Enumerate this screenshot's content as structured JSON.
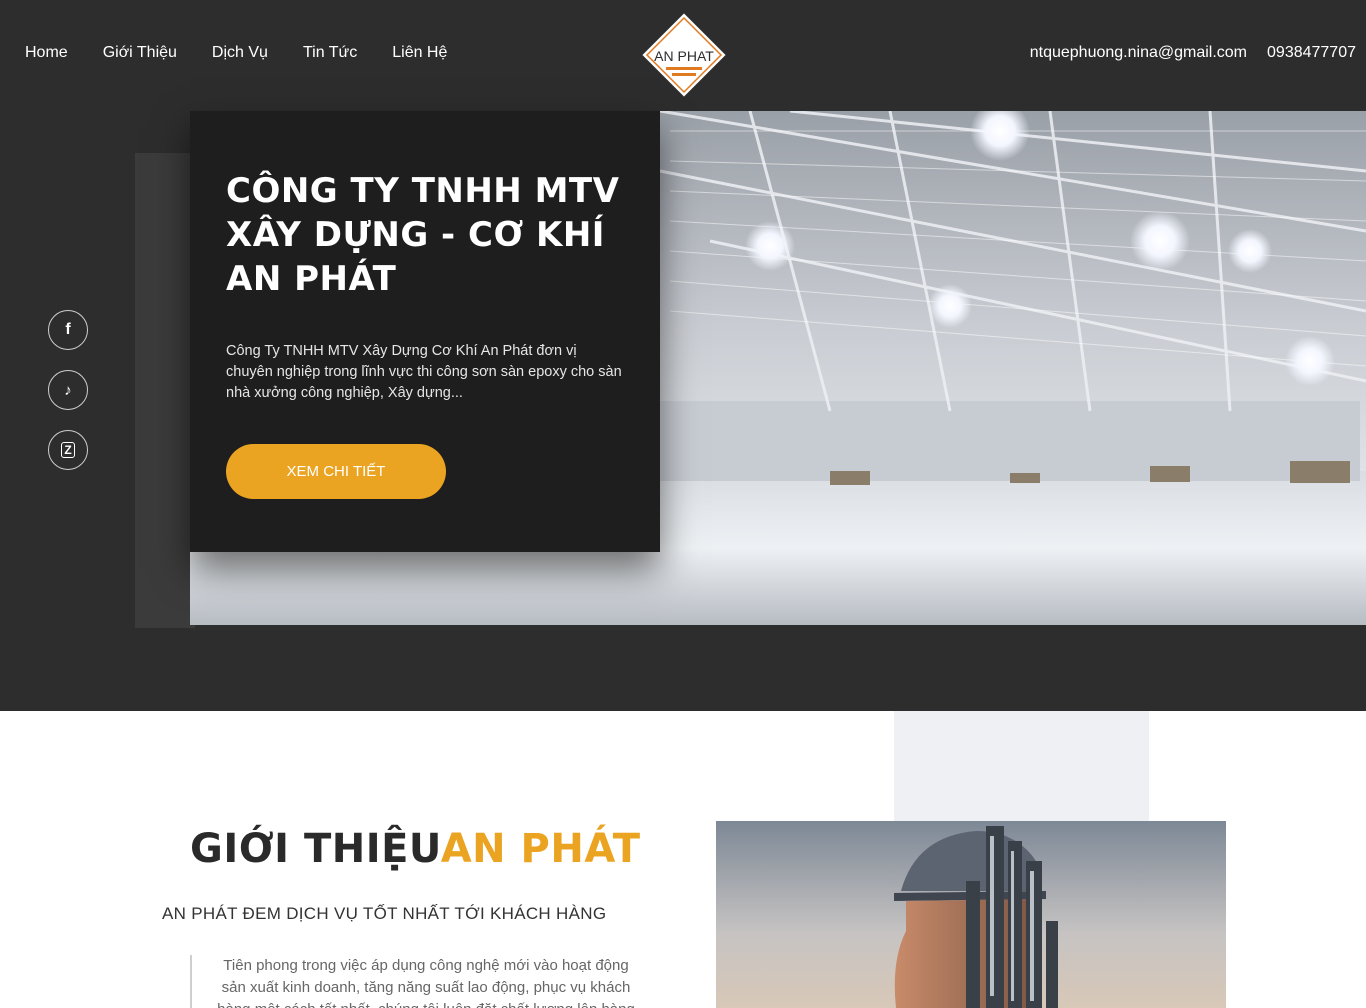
{
  "nav": {
    "items": [
      {
        "label": "Home"
      },
      {
        "label": "Giới Thiệu"
      },
      {
        "label": "Dịch Vụ"
      },
      {
        "label": "Tin Tức"
      },
      {
        "label": "Liên Hệ"
      }
    ]
  },
  "logo": {
    "text": "AN PHAT"
  },
  "contact": {
    "email": "ntquephuong.nina@gmail.com",
    "phone": "0938477707"
  },
  "hero": {
    "title_line1": "CÔNG TY TNHH MTV",
    "title_line2": "XÂY DỰNG - CƠ KHÍ",
    "title_line3": "AN PHÁT",
    "description": "Công Ty TNHH MTV Xây Dựng Cơ Khí An Phát đơn vị chuyên nghiệp trong lĩnh vực thi công sơn sàn epoxy cho sàn nhà xưởng công nghiệp, Xây dựng...",
    "button_label": "XEM CHI TIẾT"
  },
  "social": [
    {
      "icon": "facebook-icon",
      "glyph": "f"
    },
    {
      "icon": "tiktok-icon",
      "glyph": "♪"
    },
    {
      "icon": "zalo-icon",
      "glyph": "Z"
    }
  ],
  "intro": {
    "title_main": "GIỚI THIỆU",
    "title_highlight": "AN PHÁT",
    "subtitle": "AN PHÁT ĐEM DỊCH VỤ TỐT NHẤT TỚI KHÁCH HÀNG",
    "text": "Tiên phong trong việc áp dụng công nghệ mới vào hoạt động sản xuất kinh doanh, tăng năng suất lao động, phục vụ khách hàng một cách tốt nhất, chúng tôi luôn đặt chất lượng lên hàng đầu"
  },
  "colors": {
    "accent": "#eba422",
    "dark_bg": "#2d2d2d",
    "card_bg": "#1e1e1e"
  }
}
